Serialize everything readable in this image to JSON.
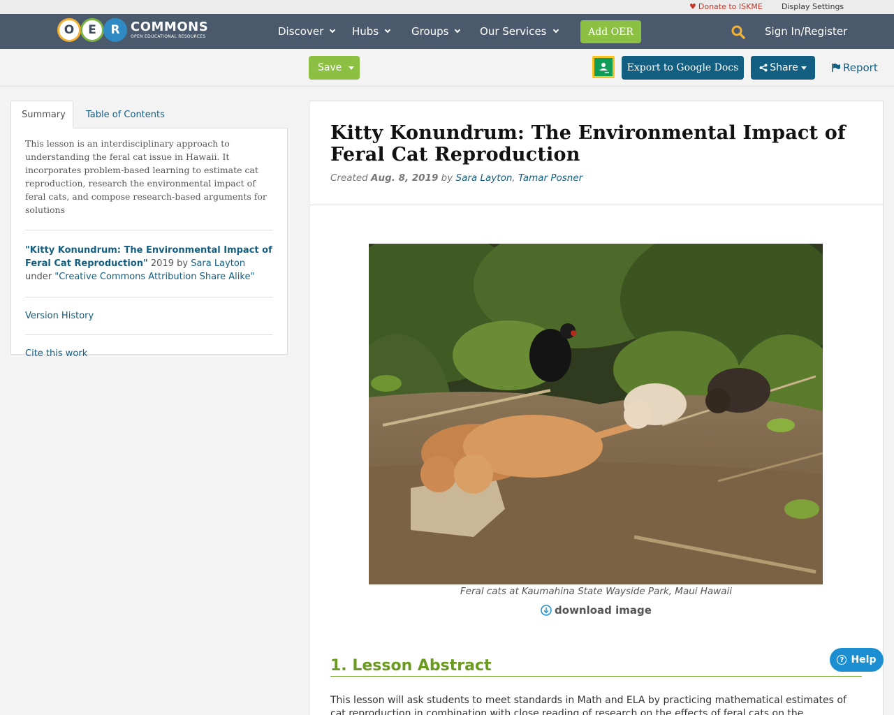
{
  "utility": {
    "donate": "Donate to ISKME",
    "display_settings": "Display Settings"
  },
  "nav": {
    "logo_letters": [
      "O",
      "E",
      "R"
    ],
    "logo_wordmark": "COMMONS",
    "logo_tagline": "OPEN EDUCATIONAL RESOURCES",
    "items": [
      "Discover",
      "Hubs",
      "Groups",
      "Our Services"
    ],
    "add_oer": "Add OER",
    "sign_in": "Sign In/Register",
    "colors": {
      "bar": "#4a5a6c",
      "green": "#8bc043",
      "blue": "#135f82"
    }
  },
  "toolbar": {
    "save": "Save",
    "export": "Export to Google Docs",
    "share": "Share",
    "report": "Report"
  },
  "sidebar": {
    "tabs": [
      "Summary",
      "Table of Contents"
    ],
    "summary": "This lesson is an interdisciplinary approach to understanding the feral cat issue in Hawaii. It incorporates problem-based learning to estimate cat reproduction, research the environmental impact of feral cats, and compose research-based arguments for solutions",
    "attribution": {
      "title": "\"Kitty Konundrum: The Environmental Impact of Feral Cat Reproduction\"",
      "year_by": " 2019 by ",
      "author": "Sara Layton",
      "under": "under ",
      "license": "\"Creative Commons Attribution Share Alike\""
    },
    "version_history": "Version History",
    "cite": "Cite this work"
  },
  "main": {
    "title": "Kitty Konundrum: The Environmental Impact of Feral Cat Reproduction",
    "created_label": "Created ",
    "created_date": "Aug. 8, 2019",
    "by": " by ",
    "author1": "Sara Layton",
    "sep": ", ",
    "author2": "Tamar Posner",
    "caption": "Feral cats at Kaumahina State Wayside Park, Maui Hawaii",
    "download": "download image",
    "section_heading": "1. Lesson Abstract",
    "body": "This lesson will ask students to meet standards in Math and ELA by practicing mathematical estimates of cat reproduction in combination with close reading of research on the effects of feral cats on the environment.  In this"
  },
  "help": "Help"
}
